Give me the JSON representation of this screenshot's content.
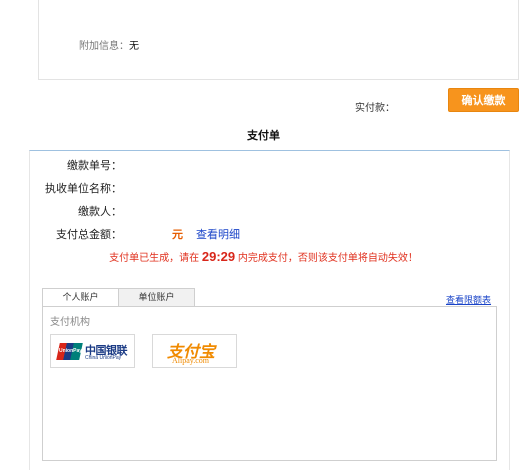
{
  "top_panel": {
    "extra_info_label": "附加信息：",
    "extra_info_value": "无"
  },
  "payment": {
    "actual_pay_label": "实付款：",
    "confirm_button": "确认缴款"
  },
  "bill": {
    "title": "支付单",
    "fields": {
      "payment_no_label": "缴款单号：",
      "collecting_unit_label": "执收单位名称：",
      "payer_label": "缴款人：",
      "total_amount_label": "支付总金额："
    },
    "amount_unit": "元",
    "view_detail_link": "查看明细",
    "notice_prefix": "支付单已生成，请在",
    "notice_timer": "29:29",
    "notice_suffix": "内完成支付，否则该支付单将自动失效！"
  },
  "tabs": {
    "personal": "个人账户",
    "company": "单位账户",
    "active": "personal"
  },
  "schedule_link": "查看限额表",
  "payment_org": {
    "label": "支付机构",
    "options": [
      {
        "name_cn": "中国银联",
        "name_en": "China UnionPay",
        "badge_text": "UnionPay",
        "icon": "unionpay-logo"
      },
      {
        "name_cn": "支付宝",
        "name_en": "Alipay.com",
        "icon": "alipay-logo"
      }
    ]
  },
  "colors": {
    "accent_orange": "#f7941d",
    "notice_red": "#e0301e",
    "link_blue": "#1a44c8"
  }
}
